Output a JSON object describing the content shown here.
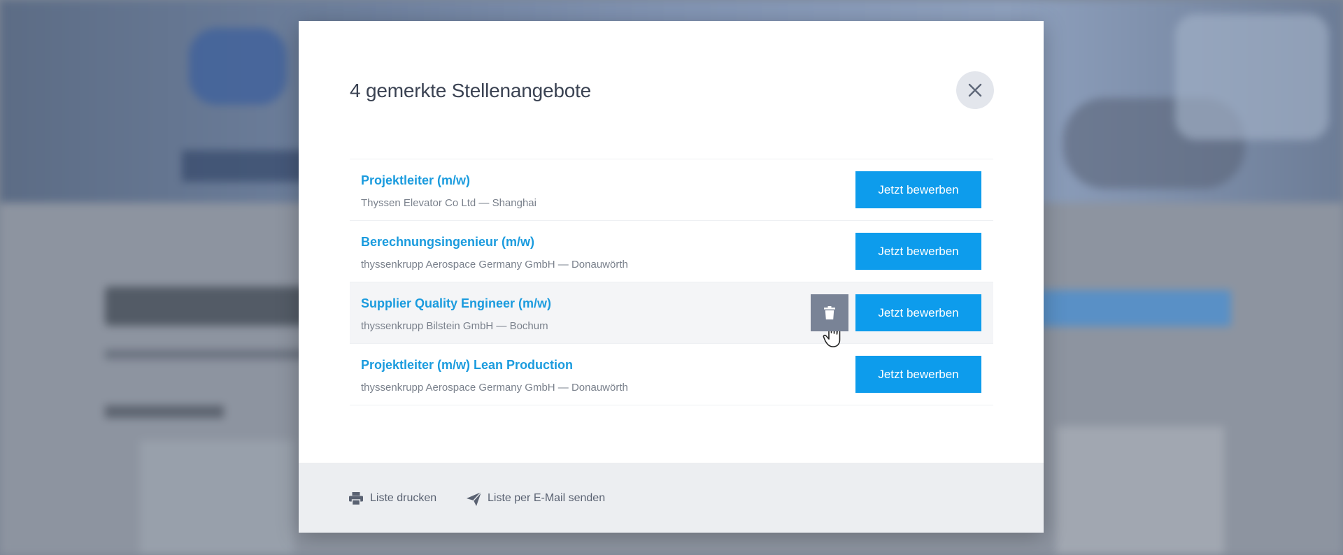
{
  "modal": {
    "title": "4 gemerkte Stellenangebote",
    "close_icon": "close-icon"
  },
  "jobs": [
    {
      "title": "Projektleiter (m/w)",
      "meta": "Thyssen Elevator Co Ltd — Shanghai",
      "apply_label": "Jetzt bewerben"
    },
    {
      "title": "Berechnungsingenieur (m/w)",
      "meta": "thyssenkrupp Aerospace Germany GmbH — Donauwörth",
      "apply_label": "Jetzt bewerben"
    },
    {
      "title": "Supplier Quality Engineer (m/w)",
      "meta": "thyssenkrupp Bilstein GmbH — Bochum",
      "apply_label": "Jetzt bewerben",
      "hovered": true,
      "delete_icon": "trash-icon"
    },
    {
      "title": "Projektleiter (m/w) Lean Production",
      "meta": "thyssenkrupp Aerospace Germany GmbH — Donauwörth",
      "apply_label": "Jetzt bewerben"
    }
  ],
  "footer": {
    "print_label": "Liste drucken",
    "print_icon": "printer-icon",
    "email_label": "Liste per E-Mail senden",
    "email_icon": "paper-plane-icon"
  },
  "colors": {
    "accent": "#0d9cec",
    "link": "#1a9bde",
    "delete": "#798396",
    "footer_bg": "#eceef1"
  }
}
